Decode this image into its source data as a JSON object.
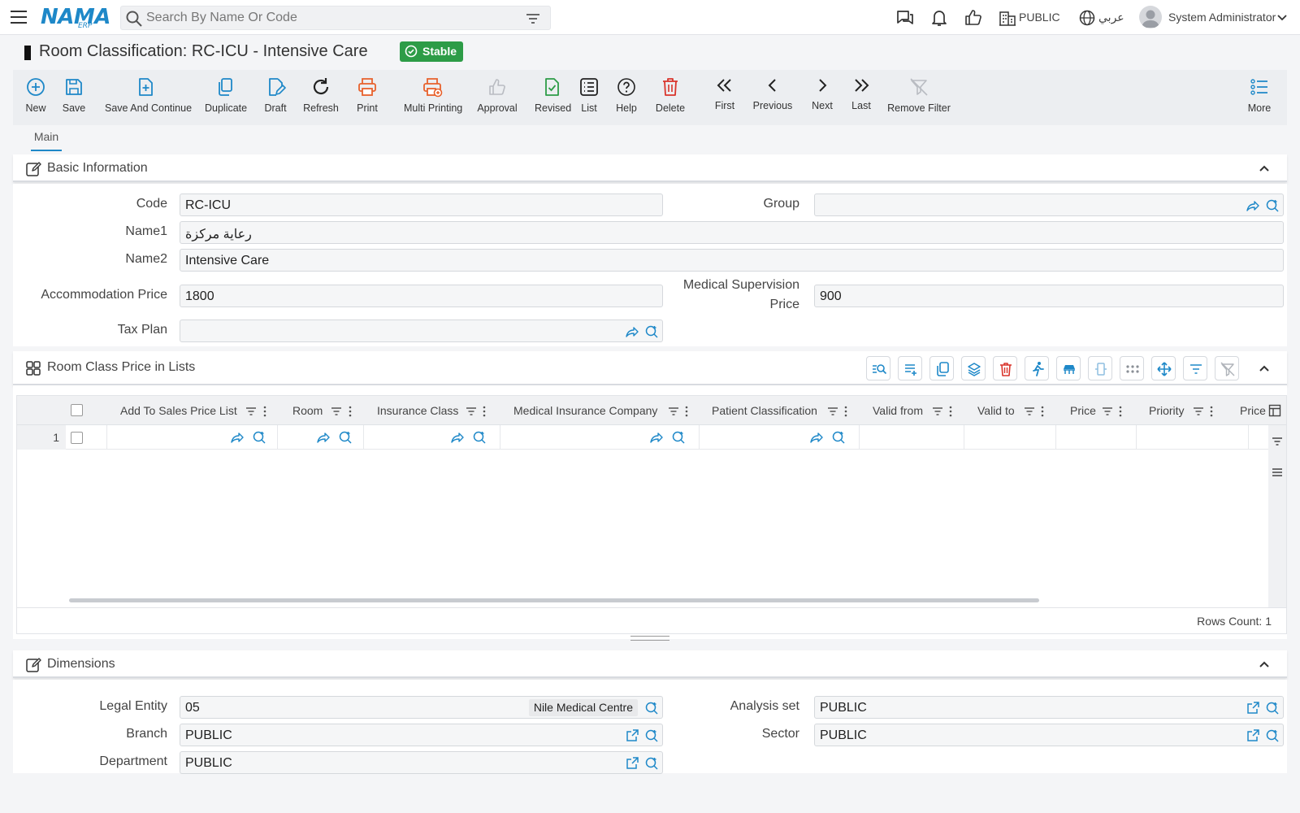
{
  "topbar": {
    "logo_main": "NAMA",
    "logo_sub": "ERP",
    "search_placeholder": "Search By Name Or Code",
    "company": "PUBLIC",
    "language": "عربي",
    "user": "System Administrator"
  },
  "title": {
    "text": "Room Classification: RC-ICU - Intensive Care",
    "status": "Stable",
    "status_color": "#2d9c47"
  },
  "toolbar": {
    "new": "New",
    "save": "Save",
    "save_continue": "Save And Continue",
    "duplicate": "Duplicate",
    "draft": "Draft",
    "refresh": "Refresh",
    "print": "Print",
    "multi_printing": "Multi Printing",
    "approval": "Approval",
    "revised": "Revised",
    "list": "List",
    "help": "Help",
    "delete": "Delete",
    "first": "First",
    "previous": "Previous",
    "next": "Next",
    "last": "Last",
    "remove_filter": "Remove Filter",
    "more": "More"
  },
  "tabs": {
    "main": "Main"
  },
  "basic": {
    "title": "Basic Information",
    "code_label": "Code",
    "code_value": "RC-ICU",
    "group_label": "Group",
    "group_value": "",
    "name1_label": "Name1",
    "name1_value": "رعاية مركزة",
    "name2_label": "Name2",
    "name2_value": "Intensive Care",
    "accommodation_label": "Accommodation Price",
    "accommodation_value": "1800",
    "medical_label_1": "Medical Supervision",
    "medical_label_2": "Price",
    "medical_value": "900",
    "tax_label": "Tax Plan",
    "tax_value": ""
  },
  "price_lists": {
    "title": "Room Class Price in Lists",
    "columns": [
      "Add To Sales Price List",
      "Room",
      "Insurance Class",
      "Medical Insurance Company",
      "Patient Classification",
      "Valid from",
      "Valid to",
      "Price",
      "Priority",
      "Price"
    ],
    "row_number": "1",
    "rows_count": "Rows Count: 1"
  },
  "dimensions": {
    "title": "Dimensions",
    "legal_entity_label": "Legal Entity",
    "legal_entity_value": "05",
    "legal_entity_name": "Nile Medical Centre",
    "analysis_label": "Analysis set",
    "analysis_value": "PUBLIC",
    "branch_label": "Branch",
    "branch_value": "PUBLIC",
    "sector_label": "Sector",
    "sector_value": "PUBLIC",
    "department_label": "Department",
    "department_value": "PUBLIC"
  },
  "colors": {
    "accent": "#1e88c8",
    "danger": "#d9342b",
    "print": "#e8612c",
    "success": "#2d9c47"
  }
}
